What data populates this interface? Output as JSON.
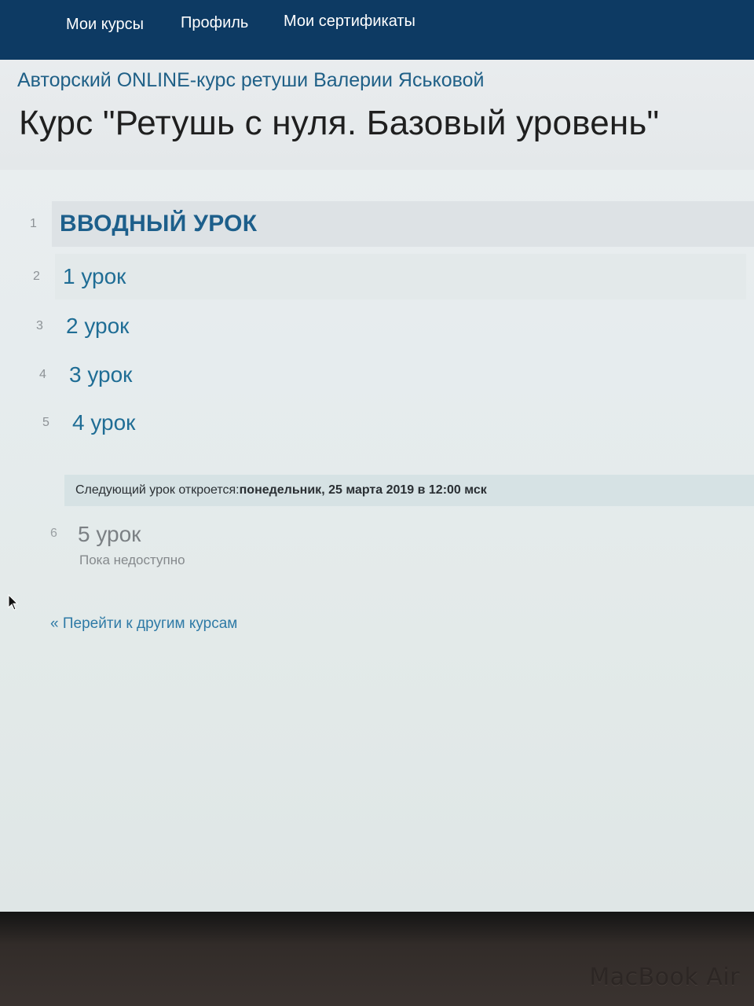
{
  "nav": {
    "items": [
      {
        "label": "Мои курсы"
      },
      {
        "label": "Профиль"
      },
      {
        "label": "Мои сертификаты"
      }
    ]
  },
  "header": {
    "school": "Авторский ONLINE-курс ретуши Валерии Яськовой",
    "title": "Курс \"Ретушь с нуля. Базовый уровень\""
  },
  "lessons": [
    {
      "num": "1",
      "title": "ВВОДНЫЙ УРОК"
    },
    {
      "num": "2",
      "title": "1 урок"
    },
    {
      "num": "3",
      "title": "2 урок"
    },
    {
      "num": "4",
      "title": "3 урок"
    },
    {
      "num": "5",
      "title": "4 урок"
    }
  ],
  "notice": {
    "prefix": "Следующий урок откроется: ",
    "date": "понедельник, 25 марта 2019 в 12:00 мск"
  },
  "locked_lesson": {
    "num": "6",
    "title": "5 урок",
    "status": "Пока недоступно"
  },
  "back_link": "« Перейти к другим курсам",
  "device_brand": "MacBook Air",
  "colors": {
    "navbar": "#0d3a63",
    "link": "#1f6d95",
    "notice_bg": "#d6e2e4"
  }
}
